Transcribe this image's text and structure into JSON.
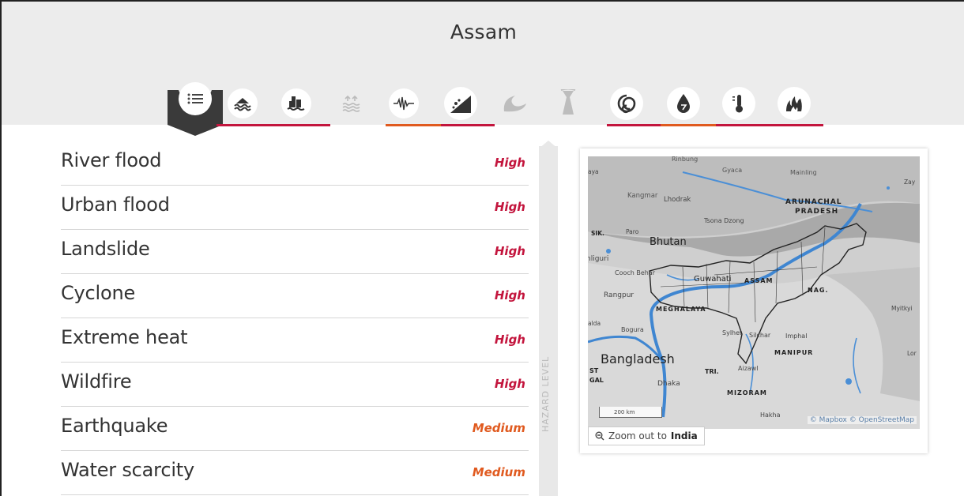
{
  "header": {
    "region_title": "Assam"
  },
  "hazard_tabs": [
    {
      "name": "overview-list-icon",
      "state": "active"
    },
    {
      "name": "river-flood-icon",
      "state": "available"
    },
    {
      "name": "urban-flood-icon",
      "state": "available"
    },
    {
      "name": "coastal-flood-icon",
      "state": "unavailable"
    },
    {
      "name": "earthquake-icon",
      "state": "available"
    },
    {
      "name": "landslide-icon",
      "state": "available"
    },
    {
      "name": "tsunami-icon",
      "state": "unavailable"
    },
    {
      "name": "volcano-icon",
      "state": "unavailable"
    },
    {
      "name": "cyclone-icon",
      "state": "available"
    },
    {
      "name": "water-scarcity-icon",
      "state": "available"
    },
    {
      "name": "extreme-heat-icon",
      "state": "available"
    },
    {
      "name": "wildfire-icon",
      "state": "available"
    }
  ],
  "colors": {
    "high": "#c3153d",
    "medium": "#e05a1f",
    "header_bg": "#ececec",
    "pointer": "#3a3a3a"
  },
  "hazards": [
    {
      "name": "River flood",
      "level": "High"
    },
    {
      "name": "Urban flood",
      "level": "High"
    },
    {
      "name": "Landslide",
      "level": "High"
    },
    {
      "name": "Cyclone",
      "level": "High"
    },
    {
      "name": "Extreme heat",
      "level": "High"
    },
    {
      "name": "Wildfire",
      "level": "High"
    },
    {
      "name": "Earthquake",
      "level": "Medium"
    },
    {
      "name": "Water scarcity",
      "level": "Medium"
    }
  ],
  "scale_label": "HAZARD LEVEL",
  "map": {
    "labels": {
      "kangmar": "Kangmar",
      "lhodrak": "Lhodrak",
      "tsona": "Tsona Dzong",
      "gyaca": "Gyaca",
      "mainling": "Mainling",
      "arunachal": "ARUNACHAL",
      "pradesh": "PRADESH",
      "bhutan": "Bhutan",
      "sik": "SIK.",
      "paro": "Paro",
      "siliguri": "nliguri",
      "cooch": "Cooch Behar",
      "guwahati": "Guwahati",
      "assam": "ASSAM",
      "nag": "NAG.",
      "rangpur": "Rangpur",
      "meghalaya": "MEGHALAYA",
      "bogura": "Bogura",
      "sylhet": "Sylhet",
      "silchar": "Silchar",
      "imphal": "Imphal",
      "bangladesh": "Bangladesh",
      "manipur": "MANIPUR",
      "tri": "TRI.",
      "aizawl": "Aizawl",
      "dhaka": "Dhaka",
      "mizoram": "MIZORAM",
      "st": "ST",
      "gal": "GAL",
      "hakha": "Hakha",
      "myitkyi": "Myitkyi",
      "zay": "Zay",
      "lor": "Lor",
      "alda": "alda",
      "ya": "aya",
      "nimbung": "Rinbung",
      "scale": "200 km"
    },
    "attribution": "© Mapbox © OpenStreetMap",
    "zoom_button": {
      "prefix": "Zoom out to",
      "target": "India"
    }
  }
}
